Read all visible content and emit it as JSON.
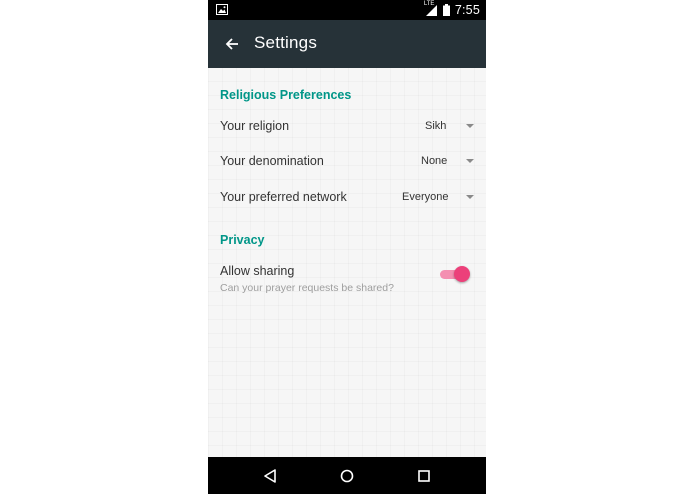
{
  "status_bar": {
    "network": "LTE",
    "time": "7:55"
  },
  "app_bar": {
    "title": "Settings",
    "back_icon": "arrow-left-icon"
  },
  "sections": {
    "religious": {
      "header": "Religious Preferences",
      "items": [
        {
          "label": "Your religion",
          "value": "Sikh"
        },
        {
          "label": "Your denomination",
          "value": "None"
        },
        {
          "label": "Your preferred network",
          "value": "Everyone"
        }
      ]
    },
    "privacy": {
      "header": "Privacy",
      "sharing": {
        "title": "Allow sharing",
        "subtitle": "Can your prayer requests be shared?",
        "enabled": true
      }
    }
  },
  "colors": {
    "accent": "#009688",
    "app_bar": "#263238",
    "toggle_on": "#ec407a"
  },
  "nav_bar": {
    "back_icon": "triangle-back-icon",
    "home_icon": "circle-home-icon",
    "recents_icon": "square-recents-icon"
  }
}
